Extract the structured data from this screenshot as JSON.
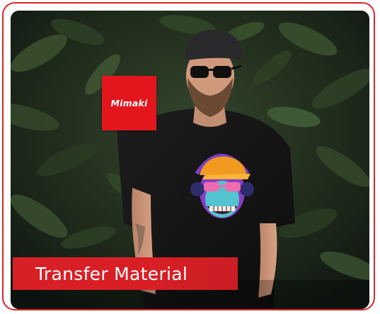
{
  "brand": {
    "logo_text": "Mimaki",
    "color": "#e3161e"
  },
  "product": {
    "title": "Transfer Material"
  },
  "colors": {
    "frame_border": "#d9252b",
    "banner": "#d91f26",
    "shirt": "#141414",
    "background_foliage": "#24321f"
  },
  "image": {
    "subject": "bearded-man-in-black-cap-and-sunglasses-wearing-black-tshirt",
    "print": "gorilla-with-headphones-and-orange-cap-graphic"
  }
}
